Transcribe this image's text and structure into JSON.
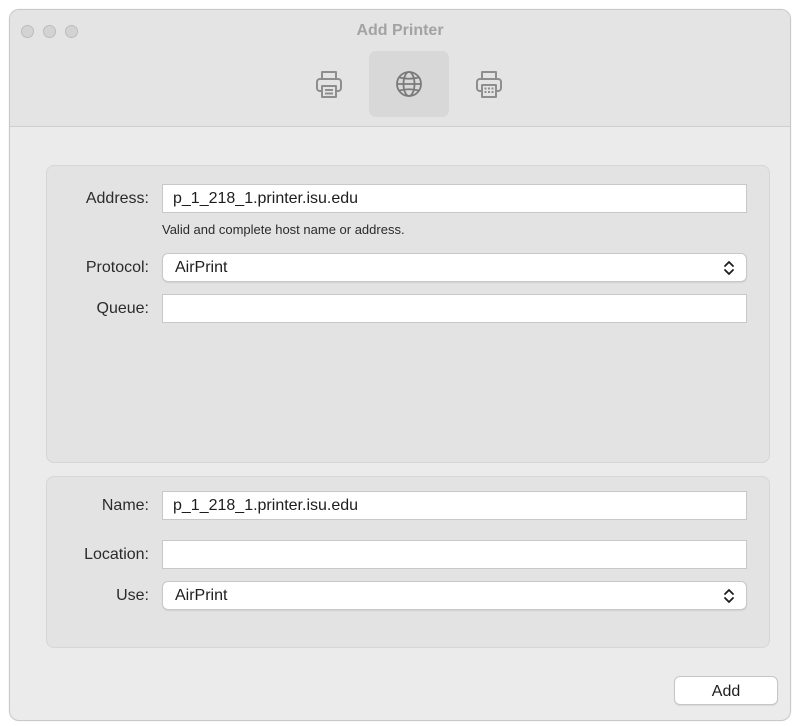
{
  "window": {
    "title": "Add Printer"
  },
  "toolbar": {
    "items": [
      {
        "icon": "default-printer-icon",
        "selected": false
      },
      {
        "icon": "ip-globe-icon",
        "selected": true
      },
      {
        "icon": "windows-printer-icon",
        "selected": false
      }
    ]
  },
  "connection": {
    "address_label": "Address:",
    "address_value": "p_1_218_1.printer.isu.edu",
    "address_hint": "Valid and complete host name or address.",
    "protocol_label": "Protocol:",
    "protocol_value": "AirPrint",
    "queue_label": "Queue:",
    "queue_value": ""
  },
  "details": {
    "name_label": "Name:",
    "name_value": "p_1_218_1.printer.isu.edu",
    "location_label": "Location:",
    "location_value": "",
    "use_label": "Use:",
    "use_value": "AirPrint"
  },
  "footer": {
    "add_label": "Add"
  }
}
